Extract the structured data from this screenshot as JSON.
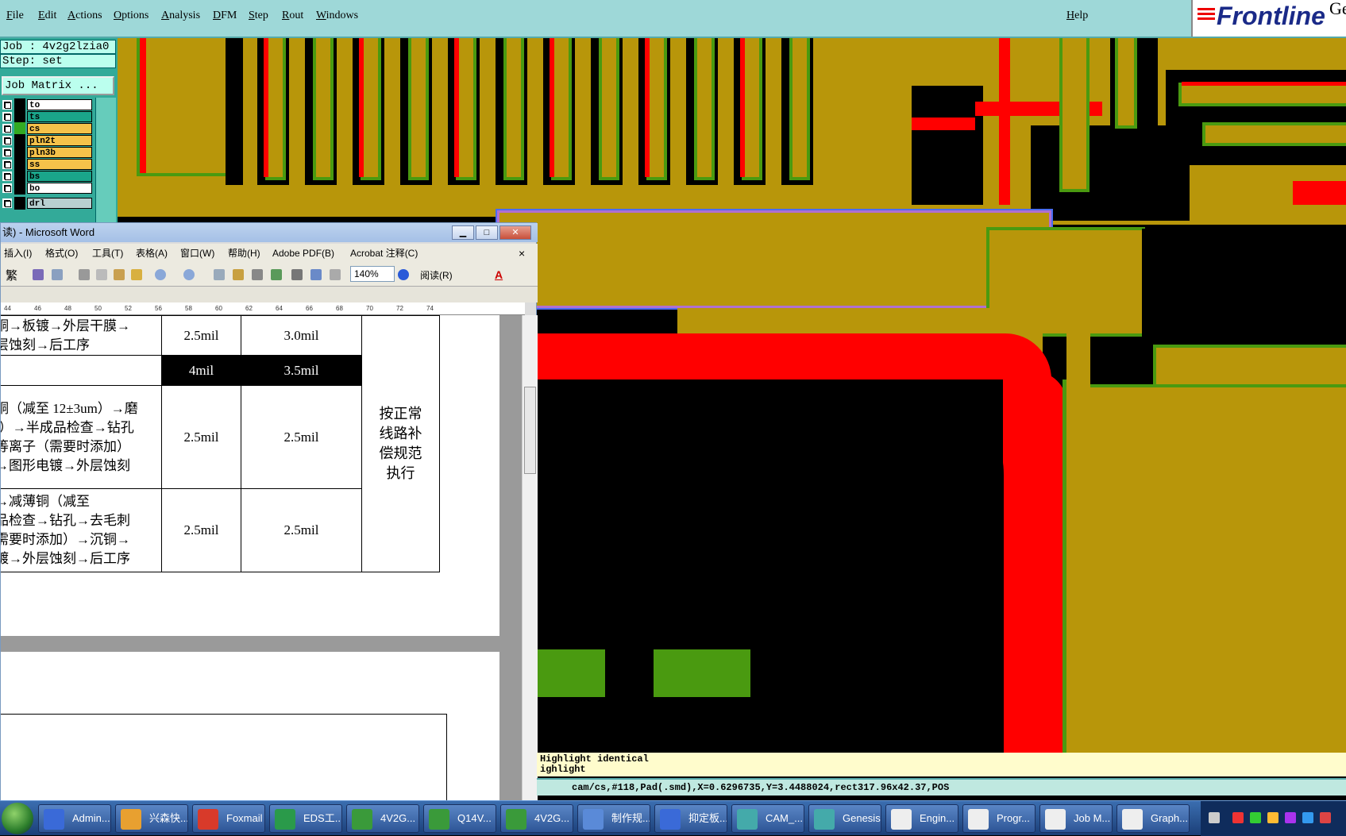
{
  "menubar": {
    "items": [
      "File",
      "Edit",
      "Actions",
      "Options",
      "Analysis",
      "DFM",
      "Step",
      "Rout",
      "Windows"
    ],
    "help": "Help",
    "logo": "Frontline",
    "logo_suffix": "Ge"
  },
  "left_panel": {
    "job_line": "Job : 4v2g2lzia0",
    "step_line": "Step: set",
    "job_matrix_button": "Job Matrix ...",
    "layers": [
      {
        "name": "to",
        "color": "#ffffff"
      },
      {
        "name": "ts",
        "color": "#1aa58a"
      },
      {
        "name": "cs",
        "color": "#f5c24a"
      },
      {
        "name": "pln2t",
        "color": "#f5c24a"
      },
      {
        "name": "pln3b",
        "color": "#f5c24a"
      },
      {
        "name": "ss",
        "color": "#f5c24a"
      },
      {
        "name": "bs",
        "color": "#1aa58a"
      },
      {
        "name": "bo",
        "color": "#ffffff"
      },
      {
        "name": "drl",
        "color": "#b8d0d0"
      }
    ]
  },
  "word": {
    "title": "读) - Microsoft Word",
    "menu": [
      "插入(I)",
      "格式(O)",
      "工具(T)",
      "表格(A)",
      "窗口(W)",
      "帮助(H)",
      "Adobe PDF(B)",
      "Acrobat 注释(C)"
    ],
    "close_glyph": "×",
    "zoom": "140%",
    "read_button": "阅读(R)",
    "font_button": "繁",
    "ruler": [
      "44",
      "46",
      "48",
      "50",
      "52",
      "56",
      "58",
      "60",
      "62",
      "64",
      "66",
      "68",
      "70",
      "72",
      "74"
    ],
    "table": {
      "rows": [
        {
          "process": [
            "铜→板镀→外层干膜→",
            "层蚀刻→后工序"
          ],
          "a": "2.5mil",
          "b": "3.0mil"
        },
        {
          "process": [],
          "a": "4mil",
          "b": "3.5mil"
        },
        {
          "process": [
            "铜（减至 12±3um）→磨",
            "l）→半成品检查→钻孔",
            "等离子（需要时添加）",
            "→图形电镀→外层蚀刻"
          ],
          "a": "2.5mil",
          "b": "2.5mil"
        },
        {
          "process": [
            "→减薄铜（减至",
            "品检查→钻孔→去毛刺",
            "需要时添加）→沉铜→",
            "镀→外层蚀刻→后工序"
          ],
          "a": "2.5mil",
          "b": "2.5mil"
        }
      ],
      "note": [
        "按正常",
        "线路补",
        "偿规范",
        "执行"
      ]
    }
  },
  "canvas": {
    "highlight_lines": [
      "Highlight identical",
      "ighlight"
    ],
    "status": "cam/cs,#118,Pad(.smd),X=0.6296735,Y=3.4488024,rect317.96x42.37,POS"
  },
  "taskbar": {
    "items": [
      "Admin...",
      "兴森快...",
      "Foxmail",
      "EDS工...",
      "4V2G...",
      "Q14V...",
      "4V2G...",
      "制作规...",
      "抑定板...",
      "CAM_...",
      "Genesis",
      "Engin...",
      "Progr...",
      "Job M...",
      "Graph..."
    ]
  }
}
